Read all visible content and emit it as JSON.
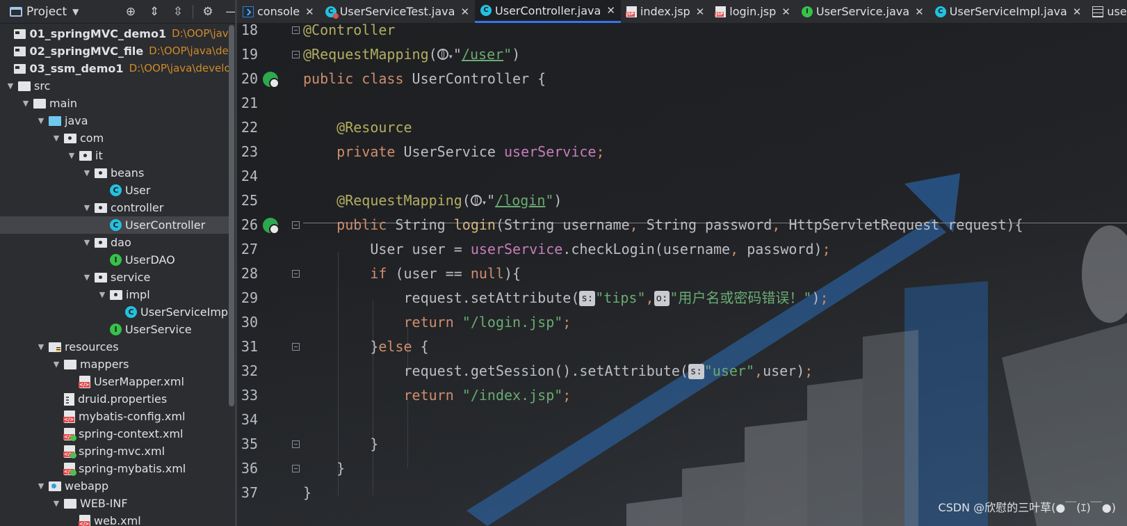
{
  "project_panel": {
    "title": "Project",
    "tools": [
      "target-icon",
      "expand-all-icon",
      "collapse-all-icon",
      "gear-icon",
      "minimize-icon"
    ],
    "tree": [
      {
        "label": "01_springMVC_demo1",
        "path": "D:\\OOP\\java\\d",
        "icon": "module",
        "depth": 0,
        "arrow": "none",
        "bold": true
      },
      {
        "label": "02_springMVC_file",
        "path": "D:\\OOP\\java\\develo",
        "icon": "module",
        "depth": 0,
        "arrow": "none",
        "bold": true
      },
      {
        "label": "03_ssm_demo1",
        "path": "D:\\OOP\\java\\develop_i",
        "icon": "module",
        "depth": 0,
        "arrow": "none",
        "bold": true
      },
      {
        "label": "src",
        "icon": "folder",
        "depth": 0,
        "arrow": "down"
      },
      {
        "label": "main",
        "icon": "folder",
        "depth": 1,
        "arrow": "down"
      },
      {
        "label": "java",
        "icon": "java-folder",
        "depth": 2,
        "arrow": "down"
      },
      {
        "label": "com",
        "icon": "package",
        "depth": 3,
        "arrow": "down"
      },
      {
        "label": "it",
        "icon": "package",
        "depth": 4,
        "arrow": "down"
      },
      {
        "label": "beans",
        "icon": "package",
        "depth": 5,
        "arrow": "down"
      },
      {
        "label": "User",
        "icon": "class",
        "depth": 6,
        "arrow": "none"
      },
      {
        "label": "controller",
        "icon": "package",
        "depth": 5,
        "arrow": "down"
      },
      {
        "label": "UserController",
        "icon": "class",
        "depth": 6,
        "arrow": "none",
        "selected": true
      },
      {
        "label": "dao",
        "icon": "package",
        "depth": 5,
        "arrow": "down"
      },
      {
        "label": "UserDAO",
        "icon": "interface",
        "depth": 6,
        "arrow": "none"
      },
      {
        "label": "service",
        "icon": "package",
        "depth": 5,
        "arrow": "down"
      },
      {
        "label": "impl",
        "icon": "package",
        "depth": 6,
        "arrow": "down"
      },
      {
        "label": "UserServiceImpl",
        "icon": "class",
        "depth": 7,
        "arrow": "none"
      },
      {
        "label": "UserService",
        "icon": "interface",
        "depth": 6,
        "arrow": "none"
      },
      {
        "label": "resources",
        "icon": "resources-folder",
        "depth": 2,
        "arrow": "down"
      },
      {
        "label": "mappers",
        "icon": "folder",
        "depth": 3,
        "arrow": "down"
      },
      {
        "label": "UserMapper.xml",
        "icon": "xml",
        "depth": 4,
        "arrow": "none"
      },
      {
        "label": "druid.properties",
        "icon": "properties",
        "depth": 3,
        "arrow": "none"
      },
      {
        "label": "mybatis-config.xml",
        "icon": "xml",
        "depth": 3,
        "arrow": "none"
      },
      {
        "label": "spring-context.xml",
        "icon": "spring-xml",
        "depth": 3,
        "arrow": "none"
      },
      {
        "label": "spring-mvc.xml",
        "icon": "spring-xml",
        "depth": 3,
        "arrow": "none"
      },
      {
        "label": "spring-mybatis.xml",
        "icon": "spring-xml",
        "depth": 3,
        "arrow": "none"
      },
      {
        "label": "webapp",
        "icon": "web-folder",
        "depth": 2,
        "arrow": "down"
      },
      {
        "label": "WEB-INF",
        "icon": "folder",
        "depth": 3,
        "arrow": "down"
      },
      {
        "label": "web.xml",
        "icon": "xml",
        "depth": 4,
        "arrow": "none"
      }
    ]
  },
  "tabs": [
    {
      "label": "console",
      "icon": "console",
      "active": false
    },
    {
      "label": "UserServiceTest.java",
      "icon": "test-class",
      "active": false
    },
    {
      "label": "UserController.java",
      "icon": "class",
      "active": true
    },
    {
      "label": "index.jsp",
      "icon": "jsp",
      "active": false
    },
    {
      "label": "login.jsp",
      "icon": "jsp",
      "active": false
    },
    {
      "label": "UserService.java",
      "icon": "interface",
      "active": false
    },
    {
      "label": "UserServiceImpl.java",
      "icon": "class",
      "active": false
    },
    {
      "label": "users",
      "icon": "table",
      "active": false
    }
  ],
  "editor": {
    "lines": [
      {
        "n": "18",
        "fold": true,
        "tokens": [
          [
            "ann",
            "@Controller"
          ]
        ]
      },
      {
        "n": "19",
        "fold": true,
        "tokens": [
          [
            "ann",
            "@RequestMapping"
          ],
          [
            "punc",
            "("
          ],
          [
            "globe",
            ""
          ],
          [
            "punc",
            "\""
          ],
          [
            "ustr",
            "/user"
          ],
          [
            "str",
            "\""
          ],
          [
            "punc",
            ")"
          ]
        ]
      },
      {
        "n": "20",
        "gutter": "spring-bean-icon",
        "tokens": [
          [
            "kw",
            "public class "
          ],
          [
            "punc",
            "UserController {"
          ]
        ]
      },
      {
        "n": "21",
        "tokens": []
      },
      {
        "n": "22",
        "tokens": [
          [
            "sp",
            "    "
          ],
          [
            "ann",
            "@Resource"
          ]
        ]
      },
      {
        "n": "23",
        "tokens": [
          [
            "sp",
            "    "
          ],
          [
            "kw",
            "private "
          ],
          [
            "punc",
            "UserService "
          ],
          [
            "fld",
            "userService"
          ],
          [
            "kw",
            ";"
          ]
        ]
      },
      {
        "n": "24",
        "tokens": []
      },
      {
        "n": "25",
        "tokens": [
          [
            "sp",
            "    "
          ],
          [
            "ann",
            "@RequestMapping"
          ],
          [
            "punc",
            "("
          ],
          [
            "globe",
            ""
          ],
          [
            "punc",
            "\""
          ],
          [
            "ustr",
            "/login"
          ],
          [
            "str",
            "\""
          ],
          [
            "punc",
            ")"
          ]
        ]
      },
      {
        "n": "26",
        "fold": true,
        "gutter": "web-endpoint-icon",
        "tokens": [
          [
            "sp",
            "    "
          ],
          [
            "kw",
            "public "
          ],
          [
            "punc",
            "String "
          ],
          [
            "meth",
            "login"
          ],
          [
            "punc",
            "(String username"
          ],
          [
            "kw",
            ", "
          ],
          [
            "punc",
            "String password"
          ],
          [
            "kw",
            ", "
          ],
          [
            "punc",
            "HttpServletRequest request){"
          ]
        ]
      },
      {
        "n": "27",
        "tokens": [
          [
            "sp",
            "        "
          ],
          [
            "punc",
            "User user = "
          ],
          [
            "fld",
            "userService"
          ],
          [
            "punc",
            ".checkLogin(username"
          ],
          [
            "kw",
            ", "
          ],
          [
            "punc",
            "password)"
          ],
          [
            "kw",
            ";"
          ]
        ]
      },
      {
        "n": "28",
        "fold": true,
        "tokens": [
          [
            "sp",
            "        "
          ],
          [
            "kw",
            "if "
          ],
          [
            "punc",
            "(user == "
          ],
          [
            "kw",
            "null"
          ],
          [
            "punc",
            "){"
          ]
        ]
      },
      {
        "n": "29",
        "tokens": [
          [
            "sp",
            "            "
          ],
          [
            "punc",
            "request.setAttribute("
          ],
          [
            "hint",
            "s:"
          ],
          [
            "str",
            "\"tips\""
          ],
          [
            "kw",
            ","
          ],
          [
            "hint",
            "o:"
          ],
          [
            "str",
            "\"用户名或密码错误！\""
          ],
          [
            "punc",
            ")"
          ],
          [
            "kw",
            ";"
          ]
        ]
      },
      {
        "n": "30",
        "tokens": [
          [
            "sp",
            "            "
          ],
          [
            "kw",
            "return "
          ],
          [
            "str",
            "\"/login.jsp\""
          ],
          [
            "kw",
            ";"
          ]
        ]
      },
      {
        "n": "31",
        "fold": true,
        "tokens": [
          [
            "sp",
            "        "
          ],
          [
            "punc",
            "}"
          ],
          [
            "kw",
            "else "
          ],
          [
            "punc",
            "{"
          ]
        ]
      },
      {
        "n": "32",
        "tokens": [
          [
            "sp",
            "            "
          ],
          [
            "punc",
            "request.getSession().setAttribute("
          ],
          [
            "hint",
            "s:"
          ],
          [
            "str",
            "\"user\""
          ],
          [
            "kw",
            ","
          ],
          [
            "punc",
            "user)"
          ],
          [
            "kw",
            ";"
          ]
        ]
      },
      {
        "n": "33",
        "tokens": [
          [
            "sp",
            "            "
          ],
          [
            "kw",
            "return "
          ],
          [
            "str",
            "\"/index.jsp\""
          ],
          [
            "kw",
            ";"
          ]
        ]
      },
      {
        "n": "34",
        "tokens": []
      },
      {
        "n": "35",
        "fold": true,
        "tokens": [
          [
            "sp",
            "        "
          ],
          [
            "punc",
            "}"
          ]
        ]
      },
      {
        "n": "36",
        "fold": true,
        "tokens": [
          [
            "sp",
            "    "
          ],
          [
            "punc",
            "}"
          ]
        ]
      },
      {
        "n": "37",
        "tokens": [
          [
            "punc",
            "}"
          ]
        ]
      }
    ]
  },
  "watermark": "CSDN @欣慰的三叶草(●￣(ｴ)￣●)"
}
